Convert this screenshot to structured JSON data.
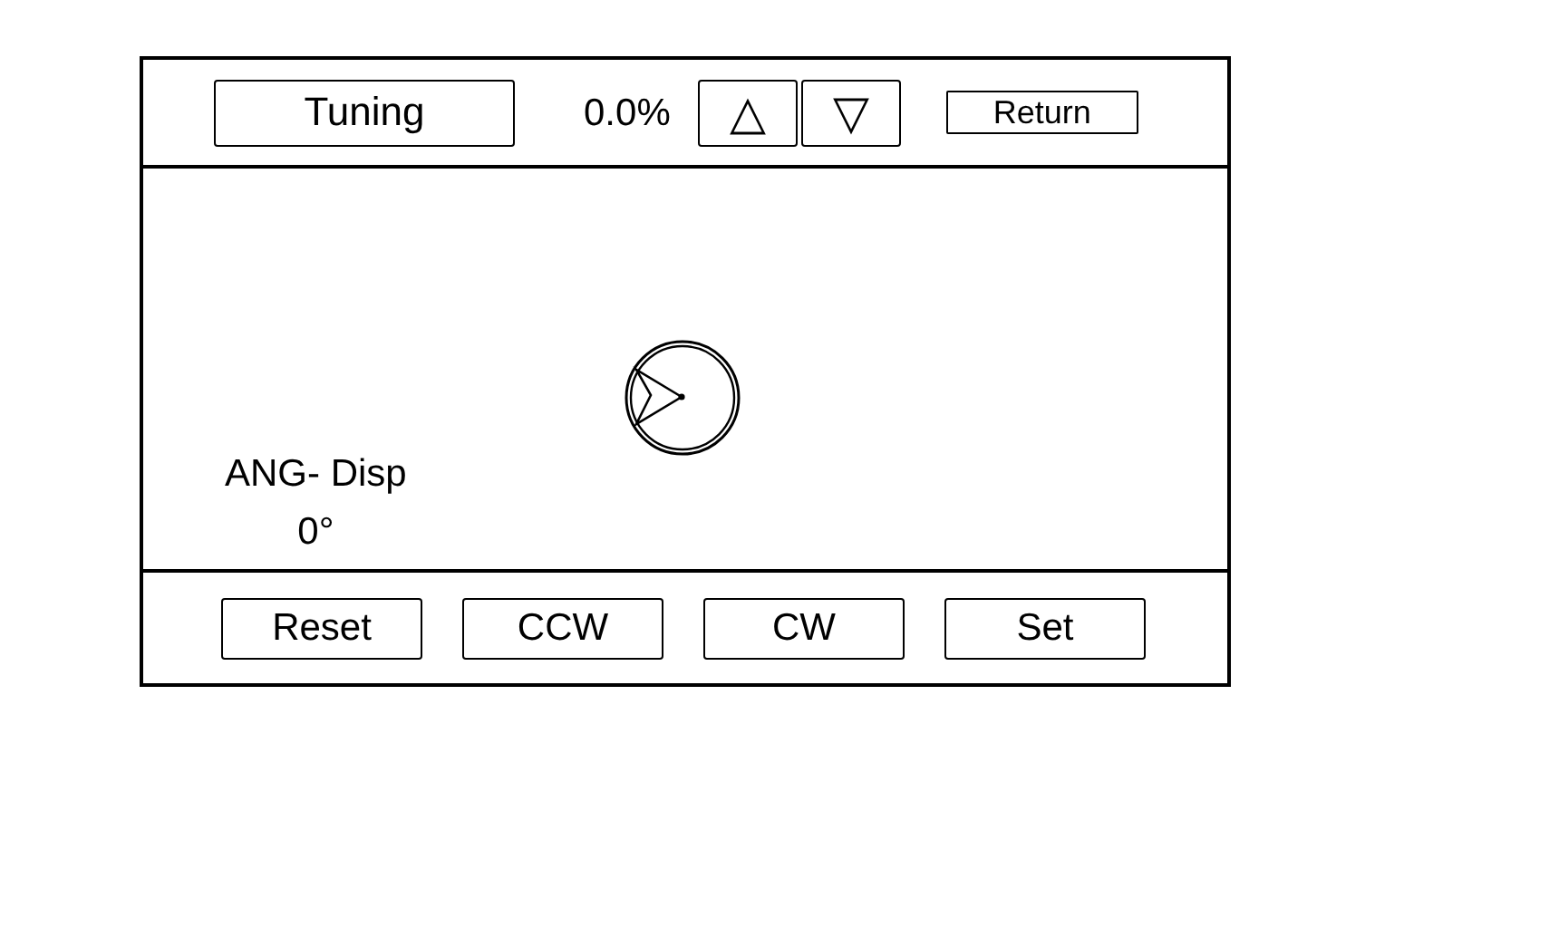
{
  "header": {
    "mode_button": "Tuning",
    "percentage": "0.0%",
    "up_button": "△",
    "down_button": "▽",
    "return_button": "Return"
  },
  "display": {
    "label": "ANG- Disp",
    "value": "0°"
  },
  "buttons": [
    "Reset",
    "CCW",
    "CW",
    "Set"
  ]
}
